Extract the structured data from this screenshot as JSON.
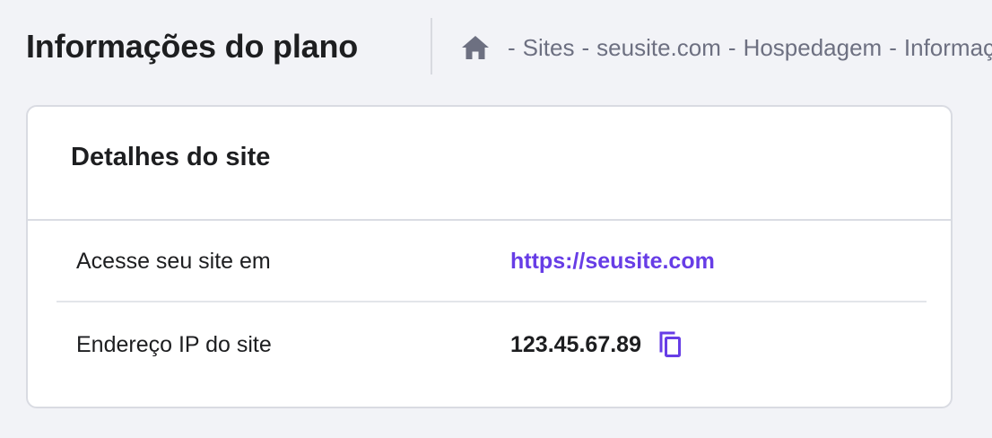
{
  "header": {
    "title": "Informações do plano",
    "breadcrumb": {
      "home_icon": "home-icon",
      "separator": "-",
      "items": [
        "Sites",
        "seusite.com",
        "Hospedagem",
        "Informações do plano"
      ]
    }
  },
  "card": {
    "title": "Detalhes do site",
    "rows": [
      {
        "label": "Acesse seu site em",
        "value": "https://seusite.com"
      },
      {
        "label": "Endereço IP do site",
        "value": "123.45.67.89",
        "action_icon": "copy-icon"
      }
    ]
  },
  "colors": {
    "accent": "#673de6",
    "background": "#f2f3f7",
    "text": "#1d1e20",
    "muted": "#6d7081"
  }
}
